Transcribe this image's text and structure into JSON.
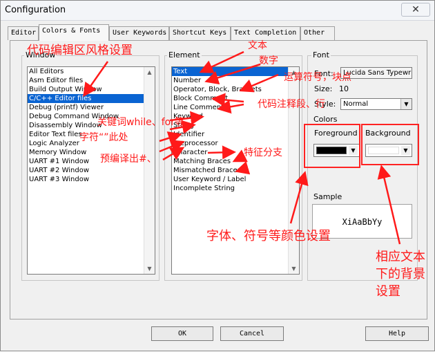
{
  "window": {
    "title": "Configuration",
    "close_glyph": "✕"
  },
  "tabs": [
    {
      "label": "Editor"
    },
    {
      "label": "Colors & Fonts"
    },
    {
      "label": "User Keywords"
    },
    {
      "label": "Shortcut Keys"
    },
    {
      "label": "Text Completion"
    },
    {
      "label": "Other"
    }
  ],
  "active_tab": "Colors & Fonts",
  "window_group": {
    "label": "Window",
    "items": [
      "All Editors",
      "Asm Editor files",
      "Build Output Window",
      "C/C++ Editor files",
      "Debug (printf) Viewer",
      "Debug Command Window",
      "Disassembly Window",
      "Editor Text files",
      "Logic Analyzer",
      "Memory Window",
      "UART #1 Window",
      "UART #2 Window",
      "UART #3 Window"
    ],
    "selected": "C/C++ Editor files"
  },
  "element_group": {
    "label": "Element",
    "items": [
      "Text",
      "Number",
      "Operator, Block, Brackets",
      "Block Comment",
      "Line Comment",
      "Keyword",
      "String",
      "Identifier",
      "Preprocessor",
      "Character",
      "Matching Braces",
      "Mismatched Braces",
      "User Keyword / Label",
      "Incomplete String"
    ],
    "selected": "Text"
  },
  "font_group": {
    "label": "Font",
    "font_label": "Font:",
    "font_value": "Lucida Sans Typewri",
    "size_label": "Size:",
    "size_value": "10",
    "style_label": "Style:",
    "style_value": "Normal"
  },
  "colors_group": {
    "label": "Colors",
    "foreground_label": "Foreground",
    "background_label": "Background",
    "foreground_color": "#000000",
    "background_color": "#ffffff"
  },
  "sample_group": {
    "label": "Sample",
    "text": "XiAaBbYy"
  },
  "buttons": {
    "ok": "OK",
    "cancel": "Cancel",
    "help": "Help"
  },
  "annotations": {
    "style_area": "代码编辑区风格设置",
    "text": "文本",
    "number": "数字",
    "operator": "运算符号，块点",
    "comment": "代码注释段、行",
    "keyword": "关键词while、for等",
    "string": "字符“”此处",
    "preprocessor": "预编译出#、",
    "character": "特征分支",
    "font_color": "字体、符号等颜色设置",
    "background": "相应文本下的背景设置"
  },
  "accent_colors": {
    "annotation": "#ff1a1a",
    "selection": "#0a64d2"
  }
}
